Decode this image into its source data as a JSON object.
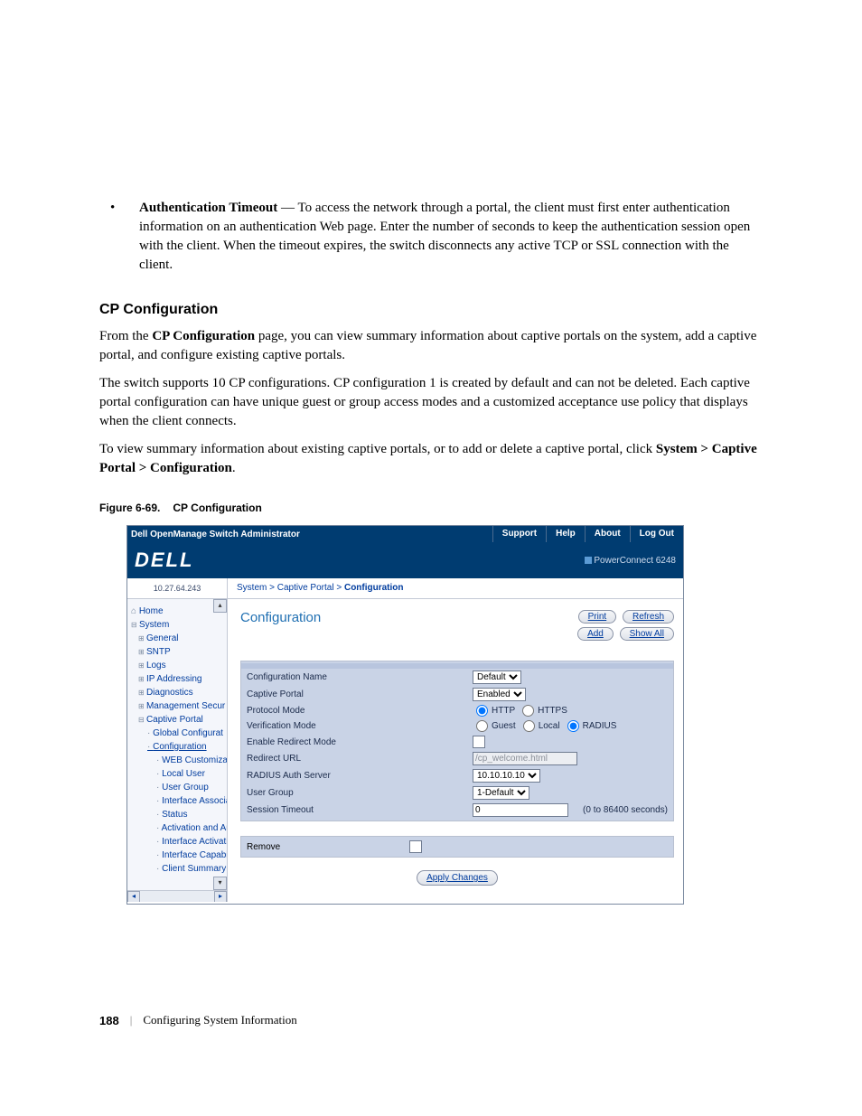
{
  "bullet": {
    "label": "Authentication Timeout",
    "text": " — To access the network through a portal, the client must first enter authentication information on an authentication Web page. Enter the number of seconds to keep the authentication session open with the client. When the timeout expires, the switch disconnects any active TCP or SSL connection with the client."
  },
  "section_title": "CP Configuration",
  "para1a": "From the ",
  "para1b": "CP Configuration",
  "para1c": " page, you can view summary information about captive portals on the system, add a captive portal, and configure existing captive portals.",
  "para2": "The switch supports 10 CP configurations. CP configuration 1 is created by default and can not be deleted. Each captive portal configuration can have unique guest or group access modes and a customized acceptance use policy that displays when the client connects.",
  "para3a": "To view summary information about existing captive portals, or to add or delete a captive portal, click ",
  "para3b": "System > Captive Portal > Configuration",
  "para3c": ".",
  "figcap_num": "Figure 6-69.",
  "figcap_title": "CP Configuration",
  "topbar_title": "Dell OpenManage Switch Administrator",
  "nav": {
    "support": "Support",
    "help": "Help",
    "about": "About",
    "logout": "Log Out"
  },
  "brand": "DELL",
  "product": "PowerConnect 6248",
  "ip": "10.27.64.243",
  "crumb": {
    "a": "System",
    "b": "Captive Portal",
    "c": "Configuration",
    "sep": ">"
  },
  "tree": {
    "home": "Home",
    "system": "System",
    "general": "General",
    "sntp": "SNTP",
    "logs": "Logs",
    "ipaddr": "IP Addressing",
    "diag": "Diagnostics",
    "mgmt": "Management Secur",
    "cp": "Captive Portal",
    "globconf": "Global Configurat",
    "config": "Configuration",
    "webcust": "WEB Customiza",
    "localuser": "Local User",
    "usergroup": "User Group",
    "ifassoc": "Interface Associa",
    "status": "Status",
    "actauth": "Activation and Au",
    "ifact": "Interface Activatio",
    "ifcap": "Interface Capabil",
    "clientsum": "Client Summary"
  },
  "content_title": "Configuration",
  "buttons": {
    "print": "Print",
    "refresh": "Refresh",
    "add": "Add",
    "showall": "Show All"
  },
  "form": {
    "confname_label": "Configuration Name",
    "confname_value": "Default",
    "cp_label": "Captive Portal",
    "cp_value": "Enabled",
    "proto_label": "Protocol Mode",
    "proto_http": "HTTP",
    "proto_https": "HTTPS",
    "verif_label": "Verification Mode",
    "verif_guest": "Guest",
    "verif_local": "Local",
    "verif_radius": "RADIUS",
    "redir_label": "Enable Redirect Mode",
    "redirurl_label": "Redirect URL",
    "redirurl_value": "/cp_welcome.html",
    "radius_label": "RADIUS Auth Server",
    "radius_value": "10.10.10.10",
    "ugroup_label": "User Group",
    "ugroup_value": "1-Default",
    "sess_label": "Session Timeout",
    "sess_value": "0",
    "sess_hint": "(0 to 86400 seconds)",
    "remove_label": "Remove",
    "apply": "Apply Changes"
  },
  "footer": {
    "page": "188",
    "title": "Configuring System Information"
  }
}
